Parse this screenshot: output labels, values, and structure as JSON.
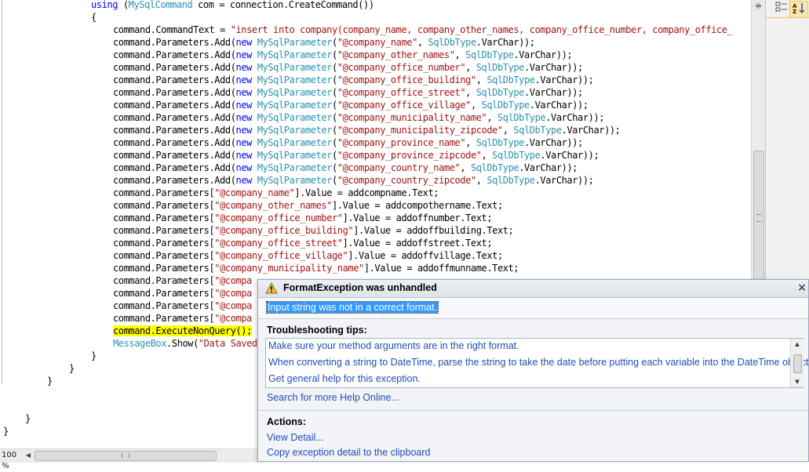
{
  "editor": {
    "lines": [
      {
        "indent": 116,
        "tokens": [
          [
            "kw",
            "using"
          ],
          [
            "plain",
            " ("
          ],
          [
            "type",
            "MySqlCommand"
          ],
          [
            "plain",
            " com = connection.CreateCommand())"
          ]
        ]
      },
      {
        "indent": 116,
        "tokens": [
          [
            "plain",
            "{"
          ]
        ]
      },
      {
        "indent": 144,
        "tokens": [
          [
            "plain",
            "command.CommandText = "
          ],
          [
            "str",
            "\"insert into company(company_name, company_other_names, company_office_number, company_office_"
          ]
        ]
      },
      {
        "indent": 144,
        "tokens": [
          [
            "plain",
            "command.Parameters.Add("
          ],
          [
            "kw",
            "new"
          ],
          [
            "plain",
            " "
          ],
          [
            "type",
            "MySqlParameter"
          ],
          [
            "plain",
            "("
          ],
          [
            "str",
            "\"@company_name\""
          ],
          [
            "plain",
            ", "
          ],
          [
            "type",
            "SqlDbType"
          ],
          [
            "plain",
            ".VarChar));"
          ]
        ]
      },
      {
        "indent": 144,
        "tokens": [
          [
            "plain",
            "command.Parameters.Add("
          ],
          [
            "kw",
            "new"
          ],
          [
            "plain",
            " "
          ],
          [
            "type",
            "MySqlParameter"
          ],
          [
            "plain",
            "("
          ],
          [
            "str",
            "\"@company_other_names\""
          ],
          [
            "plain",
            ", "
          ],
          [
            "type",
            "SqlDbType"
          ],
          [
            "plain",
            ".VarChar));"
          ]
        ]
      },
      {
        "indent": 144,
        "tokens": [
          [
            "plain",
            "command.Parameters.Add("
          ],
          [
            "kw",
            "new"
          ],
          [
            "plain",
            " "
          ],
          [
            "type",
            "MySqlParameter"
          ],
          [
            "plain",
            "("
          ],
          [
            "str",
            "\"@company_office_number\""
          ],
          [
            "plain",
            ", "
          ],
          [
            "type",
            "SqlDbType"
          ],
          [
            "plain",
            ".VarChar));"
          ]
        ]
      },
      {
        "indent": 144,
        "tokens": [
          [
            "plain",
            "command.Parameters.Add("
          ],
          [
            "kw",
            "new"
          ],
          [
            "plain",
            " "
          ],
          [
            "type",
            "MySqlParameter"
          ],
          [
            "plain",
            "("
          ],
          [
            "str",
            "\"@company_office_building\""
          ],
          [
            "plain",
            ", "
          ],
          [
            "type",
            "SqlDbType"
          ],
          [
            "plain",
            ".VarChar));"
          ]
        ]
      },
      {
        "indent": 144,
        "tokens": [
          [
            "plain",
            "command.Parameters.Add("
          ],
          [
            "kw",
            "new"
          ],
          [
            "plain",
            " "
          ],
          [
            "type",
            "MySqlParameter"
          ],
          [
            "plain",
            "("
          ],
          [
            "str",
            "\"@company_office_street\""
          ],
          [
            "plain",
            ", "
          ],
          [
            "type",
            "SqlDbType"
          ],
          [
            "plain",
            ".VarChar));"
          ]
        ]
      },
      {
        "indent": 144,
        "tokens": [
          [
            "plain",
            "command.Parameters.Add("
          ],
          [
            "kw",
            "new"
          ],
          [
            "plain",
            " "
          ],
          [
            "type",
            "MySqlParameter"
          ],
          [
            "plain",
            "("
          ],
          [
            "str",
            "\"@company_office_village\""
          ],
          [
            "plain",
            ", "
          ],
          [
            "type",
            "SqlDbType"
          ],
          [
            "plain",
            ".VarChar));"
          ]
        ]
      },
      {
        "indent": 144,
        "tokens": [
          [
            "plain",
            "command.Parameters.Add("
          ],
          [
            "kw",
            "new"
          ],
          [
            "plain",
            " "
          ],
          [
            "type",
            "MySqlParameter"
          ],
          [
            "plain",
            "("
          ],
          [
            "str",
            "\"@company_municipality_name\""
          ],
          [
            "plain",
            ", "
          ],
          [
            "type",
            "SqlDbType"
          ],
          [
            "plain",
            ".VarChar));"
          ]
        ]
      },
      {
        "indent": 144,
        "tokens": [
          [
            "plain",
            "command.Parameters.Add("
          ],
          [
            "kw",
            "new"
          ],
          [
            "plain",
            " "
          ],
          [
            "type",
            "MySqlParameter"
          ],
          [
            "plain",
            "("
          ],
          [
            "str",
            "\"@company_municipality_zipcode\""
          ],
          [
            "plain",
            ", "
          ],
          [
            "type",
            "SqlDbType"
          ],
          [
            "plain",
            ".VarChar));"
          ]
        ]
      },
      {
        "indent": 144,
        "tokens": [
          [
            "plain",
            "command.Parameters.Add("
          ],
          [
            "kw",
            "new"
          ],
          [
            "plain",
            " "
          ],
          [
            "type",
            "MySqlParameter"
          ],
          [
            "plain",
            "("
          ],
          [
            "str",
            "\"@company_province_name\""
          ],
          [
            "plain",
            ", "
          ],
          [
            "type",
            "SqlDbType"
          ],
          [
            "plain",
            ".VarChar));"
          ]
        ]
      },
      {
        "indent": 144,
        "tokens": [
          [
            "plain",
            "command.Parameters.Add("
          ],
          [
            "kw",
            "new"
          ],
          [
            "plain",
            " "
          ],
          [
            "type",
            "MySqlParameter"
          ],
          [
            "plain",
            "("
          ],
          [
            "str",
            "\"@company_province_zipcode\""
          ],
          [
            "plain",
            ", "
          ],
          [
            "type",
            "SqlDbType"
          ],
          [
            "plain",
            ".VarChar));"
          ]
        ]
      },
      {
        "indent": 144,
        "tokens": [
          [
            "plain",
            "command.Parameters.Add("
          ],
          [
            "kw",
            "new"
          ],
          [
            "plain",
            " "
          ],
          [
            "type",
            "MySqlParameter"
          ],
          [
            "plain",
            "("
          ],
          [
            "str",
            "\"@company_country_name\""
          ],
          [
            "plain",
            ", "
          ],
          [
            "type",
            "SqlDbType"
          ],
          [
            "plain",
            ".VarChar));"
          ]
        ]
      },
      {
        "indent": 144,
        "tokens": [
          [
            "plain",
            "command.Parameters.Add("
          ],
          [
            "kw",
            "new"
          ],
          [
            "plain",
            " "
          ],
          [
            "type",
            "MySqlParameter"
          ],
          [
            "plain",
            "("
          ],
          [
            "str",
            "\"@company_country_zipcode\""
          ],
          [
            "plain",
            ", "
          ],
          [
            "type",
            "SqlDbType"
          ],
          [
            "plain",
            ".VarChar));"
          ]
        ]
      },
      {
        "indent": 144,
        "tokens": [
          [
            "plain",
            "command.Parameters["
          ],
          [
            "str",
            "\"@company_name\""
          ],
          [
            "plain",
            "].Value = addcompname.Text;"
          ]
        ]
      },
      {
        "indent": 144,
        "tokens": [
          [
            "plain",
            "command.Parameters["
          ],
          [
            "str",
            "\"@company_other_names\""
          ],
          [
            "plain",
            "].Value = addcompothername.Text;"
          ]
        ]
      },
      {
        "indent": 144,
        "tokens": [
          [
            "plain",
            "command.Parameters["
          ],
          [
            "str",
            "\"@company_office_number\""
          ],
          [
            "plain",
            "].Value = addoffnumber.Text;"
          ]
        ]
      },
      {
        "indent": 144,
        "tokens": [
          [
            "plain",
            "command.Parameters["
          ],
          [
            "str",
            "\"@company_office_building\""
          ],
          [
            "plain",
            "].Value = addoffbuilding.Text;"
          ]
        ]
      },
      {
        "indent": 144,
        "tokens": [
          [
            "plain",
            "command.Parameters["
          ],
          [
            "str",
            "\"@company_office_street\""
          ],
          [
            "plain",
            "].Value = addoffstreet.Text;"
          ]
        ]
      },
      {
        "indent": 144,
        "tokens": [
          [
            "plain",
            "command.Parameters["
          ],
          [
            "str",
            "\"@company_office_village\""
          ],
          [
            "plain",
            "].Value = addoffvillage.Text;"
          ]
        ]
      },
      {
        "indent": 144,
        "tokens": [
          [
            "plain",
            "command.Parameters["
          ],
          [
            "str",
            "\"@company_municipality_name\""
          ],
          [
            "plain",
            "].Value = addoffmunname.Text;"
          ]
        ]
      },
      {
        "indent": 144,
        "tokens": [
          [
            "plain",
            "command.Parameters["
          ],
          [
            "str",
            "\"@compa"
          ]
        ]
      },
      {
        "indent": 144,
        "tokens": [
          [
            "plain",
            "command.Parameters["
          ],
          [
            "str",
            "\"@compa"
          ]
        ]
      },
      {
        "indent": 144,
        "tokens": [
          [
            "plain",
            "command.Parameters["
          ],
          [
            "str",
            "\"@compa"
          ]
        ]
      },
      {
        "indent": 144,
        "tokens": [
          [
            "plain",
            "command.Parameters["
          ],
          [
            "str",
            "\"@compa"
          ]
        ]
      },
      {
        "indent": 144,
        "tokens": [
          [
            "hl",
            "command.ExecuteNonQuery();"
          ]
        ]
      },
      {
        "indent": 144,
        "tokens": [
          [
            "type",
            "MessageBox"
          ],
          [
            "plain",
            ".Show("
          ],
          [
            "str",
            "\"Data Saved"
          ]
        ]
      },
      {
        "indent": 116,
        "tokens": [
          [
            "plain",
            "}"
          ]
        ]
      },
      {
        "indent": 88,
        "tokens": [
          [
            "plain",
            "}"
          ]
        ]
      },
      {
        "indent": 60,
        "tokens": [
          [
            "plain",
            "}"
          ]
        ]
      },
      {
        "indent": 0,
        "tokens": [
          [
            "plain",
            ""
          ]
        ]
      },
      {
        "indent": 0,
        "tokens": [
          [
            "plain",
            ""
          ]
        ]
      },
      {
        "indent": 32,
        "tokens": [
          [
            "plain",
            "}"
          ]
        ]
      },
      {
        "indent": 4,
        "tokens": [
          [
            "plain",
            "}"
          ]
        ]
      }
    ]
  },
  "status": {
    "zoom": "100 %"
  },
  "right_toolbar": {
    "categorized_icon": "categorized-icon",
    "alphabetical_icon": "alphabetical-sort-icon"
  },
  "exception": {
    "title": "FormatException was unhandled",
    "message": "Input string was not in a correct format.",
    "tips_label": "Troubleshooting tips:",
    "tips": [
      "Make sure your method arguments are in the right format.",
      "When converting a string to DateTime, parse the string to take the date before putting each variable into the DateTime object.",
      "Get general help for this exception."
    ],
    "help_online": "Search for more Help Online...",
    "actions_label": "Actions:",
    "actions": [
      "View Detail...",
      "Copy exception detail to the clipboard"
    ],
    "close_glyph": "×"
  },
  "colors": {
    "keyword": "#0000ff",
    "type": "#2b91af",
    "string": "#a31515",
    "highlight": "#ffff00",
    "link": "#1f4fb5",
    "selection": "#3399ff"
  }
}
